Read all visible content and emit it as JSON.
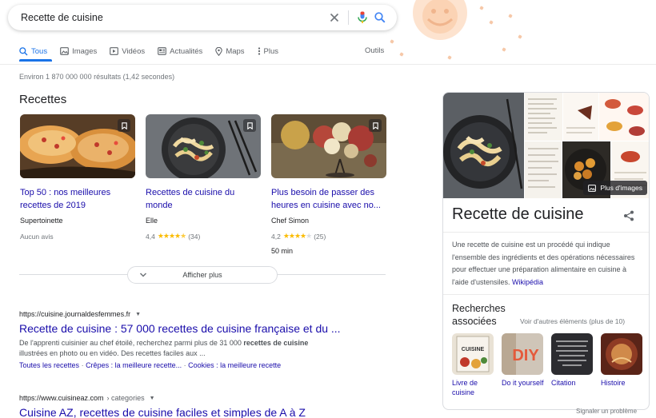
{
  "search": {
    "query": "Recette de cuisine"
  },
  "tabs": [
    {
      "label": "Tous",
      "icon": "search-icon"
    },
    {
      "label": "Images",
      "icon": "image-icon"
    },
    {
      "label": "Vidéos",
      "icon": "video-icon"
    },
    {
      "label": "Actualités",
      "icon": "news-icon"
    },
    {
      "label": "Maps",
      "icon": "map-pin-icon"
    },
    {
      "label": "Plus",
      "icon": "more-vert-icon"
    }
  ],
  "tools_label": "Outils",
  "result_stats": "Environ 1 870 000 000 résultats (1,42 secondes)",
  "recipes": {
    "heading": "Recettes",
    "cards": [
      {
        "title": "Top 50 : nos meilleures recettes de 2019",
        "source": "Supertoinette",
        "rating_text": "Aucun avis",
        "rating": null,
        "reviews": "",
        "time": ""
      },
      {
        "title": "Recettes de cuisine du monde",
        "source": "Elle",
        "rating_text": "4,4",
        "rating": 4.4,
        "reviews": "(34)",
        "time": ""
      },
      {
        "title": "Plus besoin de passer des heures en cuisine avec no...",
        "source": "Chef Simon",
        "rating_text": "4,2",
        "rating": 4.2,
        "reviews": "(25)",
        "time": "50 min"
      }
    ],
    "show_more": "Afficher plus"
  },
  "results": [
    {
      "url": "https://cuisine.journaldesfemmes.fr",
      "title": "Recette de cuisine : 57 000 recettes de cuisine française et du ...",
      "desc_1": "De l'apprenti cuisinier au chef étoilé, recherchez parmi plus de 31 000 ",
      "desc_bold": "recettes de cuisine",
      "desc_2": "illustrées en photo ou en vidéo. Des recettes faciles aux ...",
      "sublinks": [
        "Toutes les recettes",
        "Crêpes : la meilleure recette...",
        "Cookies : la meilleure recette"
      ]
    },
    {
      "url": "https://www.cuisineaz.com",
      "breadcrumb": "› categories",
      "title": "Cuisine AZ, recettes de cuisine faciles et simples de A à Z"
    }
  ],
  "knowledge_panel": {
    "more_images": "Plus d'images",
    "title": "Recette de cuisine",
    "description": "Une recette de cuisine est un procédé qui indique l'ensemble des ingrédients et des opérations nécessaires pour effectuer une préparation alimentaire en cuisine à l'aide d'ustensiles. ",
    "wiki_link": "Wikipédia",
    "related_heading": "Recherches associées",
    "see_more": "Voir d'autres éléments (plus de 10)",
    "related": [
      {
        "label": "Livre de cuisine",
        "thumb_text": "CUISINE"
      },
      {
        "label": "Do it yourself",
        "thumb_text": "DIY"
      },
      {
        "label": "Citation",
        "thumb_text": ""
      },
      {
        "label": "Histoire",
        "thumb_text": ""
      }
    ]
  },
  "report_link": "Signaler un problème",
  "colors": {
    "link": "#1a0dab",
    "accent": "#1a73e8",
    "star": "#fbbc04"
  }
}
